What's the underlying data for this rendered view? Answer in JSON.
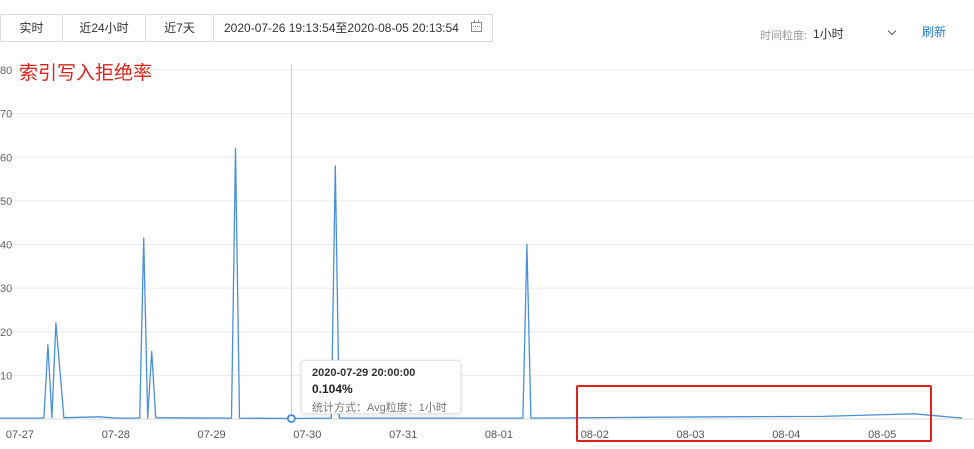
{
  "toolbar": {
    "realtime_label": "实时",
    "last24h_label": "近24小时",
    "last7d_label": "近7天",
    "date_range": "2020-07-26 19:13:54至2020-08-05 20:13:54"
  },
  "granularity": {
    "label": "时间粒度:",
    "value": "1小时"
  },
  "refresh_label": "刷新",
  "tooltip": {
    "time": "2020-07-29 20:00:00",
    "value": "0.104%",
    "meta": "统计方式：Avg粒度：1小时"
  },
  "chart_data": {
    "type": "line",
    "title": "索引写入拒绝率",
    "xlabel": "",
    "ylabel": "",
    "ylim": [
      0,
      80
    ],
    "yticks": [
      10,
      20,
      30,
      40,
      50,
      60,
      70,
      80
    ],
    "x_tick_labels": [
      "07-27",
      "07-28",
      "07-29",
      "07-30",
      "07-31",
      "08-01",
      "08-02",
      "08-03",
      "08-04",
      "08-05"
    ],
    "x_start": "2020-07-26 19:00",
    "x_end": "2020-08-05 20:00",
    "grid": true,
    "series": [
      {
        "name": "",
        "color": "#4a90d9",
        "points": [
          [
            "2020-07-26 19:00",
            0.2
          ],
          [
            "2020-07-27 06:00",
            0.2
          ],
          [
            "2020-07-27 07:00",
            17
          ],
          [
            "2020-07-27 08:00",
            0.3
          ],
          [
            "2020-07-27 09:00",
            22
          ],
          [
            "2020-07-27 11:00",
            0.3
          ],
          [
            "2020-07-27 20:00",
            0.5
          ],
          [
            "2020-07-28 00:00",
            0.2
          ],
          [
            "2020-07-28 06:00",
            0.2
          ],
          [
            "2020-07-28 07:00",
            41.5
          ],
          [
            "2020-07-28 08:00",
            0.2
          ],
          [
            "2020-07-28 09:00",
            15.5
          ],
          [
            "2020-07-28 10:00",
            0.3
          ],
          [
            "2020-07-29 05:00",
            0.2
          ],
          [
            "2020-07-29 06:00",
            62
          ],
          [
            "2020-07-29 07:00",
            0.2
          ],
          [
            "2020-07-29 20:00",
            0.104
          ],
          [
            "2020-07-30 06:00",
            0.2
          ],
          [
            "2020-07-30 07:00",
            58
          ],
          [
            "2020-07-30 08:00",
            0.2
          ],
          [
            "2020-08-01 06:00",
            0.2
          ],
          [
            "2020-08-01 07:00",
            40
          ],
          [
            "2020-08-01 08:00",
            0.2
          ],
          [
            "2020-08-02 12:00",
            0.4
          ],
          [
            "2020-08-03 07:00",
            0.5
          ],
          [
            "2020-08-04 09:00",
            0.6
          ],
          [
            "2020-08-05 08:00",
            1.2
          ],
          [
            "2020-08-05 20:00",
            0.2
          ]
        ]
      }
    ],
    "highlighted_point": [
      "2020-07-29 20:00",
      0.104
    ]
  }
}
